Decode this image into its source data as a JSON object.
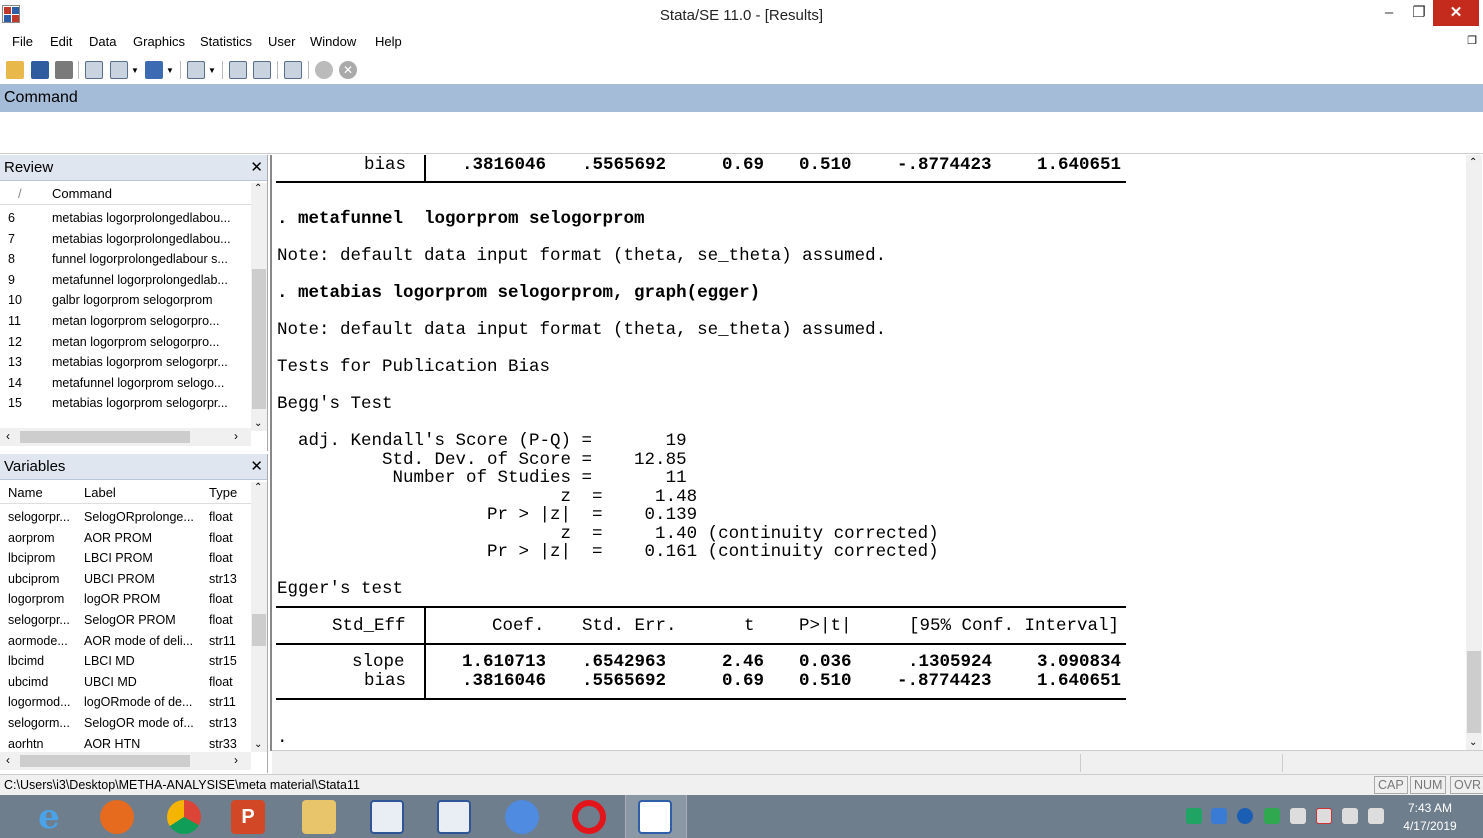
{
  "window": {
    "title": "Stata/SE 11.0 - [Results]"
  },
  "menu": [
    "File",
    "Edit",
    "Data",
    "Graphics",
    "Statistics",
    "User",
    "Window",
    "Help"
  ],
  "command": {
    "header": "Command"
  },
  "review": {
    "title": "Review",
    "col_num": "/",
    "col_command": "Command",
    "rows": [
      {
        "n": "6",
        "cmd": "metabias logorprolongedlabou..."
      },
      {
        "n": "7",
        "cmd": "metabias logorprolongedlabou..."
      },
      {
        "n": "8",
        "cmd": "funnel logorprolongedlabour s..."
      },
      {
        "n": "9",
        "cmd": "metafunnel logorprolongedlab..."
      },
      {
        "n": "10",
        "cmd": "galbr logorprom selogorprom"
      },
      {
        "n": "11",
        "cmd": "metan logorprom selogorpro..."
      },
      {
        "n": "12",
        "cmd": "metan logorprom selogorpro..."
      },
      {
        "n": "13",
        "cmd": "metabias logorprom selogorpr..."
      },
      {
        "n": "14",
        "cmd": "metafunnel  logorprom selogo..."
      },
      {
        "n": "15",
        "cmd": "metabias logorprom selogorpr..."
      }
    ]
  },
  "variables": {
    "title": "Variables",
    "col_name": "Name",
    "col_label": "Label",
    "col_type": "Type",
    "rows": [
      {
        "name": "selogorpr...",
        "label": "SelogORprolonge...",
        "type": "float"
      },
      {
        "name": "aorprom",
        "label": "AOR PROM",
        "type": "float"
      },
      {
        "name": "lbciprom",
        "label": "LBCI PROM",
        "type": "float"
      },
      {
        "name": "ubciprom",
        "label": "UBCI PROM",
        "type": "str13"
      },
      {
        "name": "logorprom",
        "label": "logOR PROM",
        "type": "float"
      },
      {
        "name": "selogorpr...",
        "label": "SelogOR PROM",
        "type": "float"
      },
      {
        "name": "aormode...",
        "label": "AOR mode of deli...",
        "type": "str11"
      },
      {
        "name": "lbcimd",
        "label": "LBCI MD",
        "type": "str15"
      },
      {
        "name": "ubcimd",
        "label": "UBCI MD",
        "type": "float"
      },
      {
        "name": "logormod...",
        "label": "logORmode of de...",
        "type": "str11"
      },
      {
        "name": "selogorm...",
        "label": "SelogOR mode of...",
        "type": "str13"
      },
      {
        "name": "aorhtn",
        "label": "AOR HTN",
        "type": "str33"
      }
    ]
  },
  "results": {
    "top_row": {
      "label": "bias",
      "coef": ".3816046",
      "se": ".5565692",
      "t": "0.69",
      "p": "0.510",
      "lo": "-.8774423",
      "hi": "1.640651"
    },
    "cmd1": ". metafunnel  logorprom selogorprom",
    "note1": "Note: default data input format (theta, se_theta) assumed.",
    "cmd2": ". metabias logorprom selogorprom, graph(egger)",
    "note2": "Note: default data input format (theta, se_theta) assumed.",
    "tests_title": "Tests for Publication Bias",
    "begg_title": "Begg's Test",
    "begg_lines": [
      "  adj. Kendall's Score (P-Q) =       19",
      "          Std. Dev. of Score =    12.85",
      "           Number of Studies =       11",
      "                           z  =     1.48",
      "                    Pr > |z|  =    0.139",
      "                           z  =     1.40 (continuity corrected)",
      "                    Pr > |z|  =    0.161 (continuity corrected)"
    ],
    "egger_title": "Egger's test",
    "egger_header": {
      "label": "Std_Eff",
      "coef": "Coef.",
      "se": "Std. Err.",
      "t": "t",
      "p": "P>|t|",
      "ci": "[95% Conf. Interval]"
    },
    "egger_rows": [
      {
        "label": "slope",
        "coef": "1.610713",
        "se": ".6542963",
        "t": "2.46",
        "p": "0.036",
        "lo": ".1305924",
        "hi": "3.090834"
      },
      {
        "label": "bias",
        "coef": ".3816046",
        "se": ".5565692",
        "t": "0.69",
        "p": "0.510",
        "lo": "-.8774423",
        "hi": "1.640651"
      }
    ],
    "prompt": "."
  },
  "status": {
    "path": "C:\\Users\\i3\\Desktop\\METHA-ANALYSISE\\meta material\\Stata11",
    "cap": "CAP",
    "num": "NUM",
    "ovr": "OVR"
  },
  "clock": {
    "time": "7:43 AM",
    "date": "4/17/2019"
  }
}
